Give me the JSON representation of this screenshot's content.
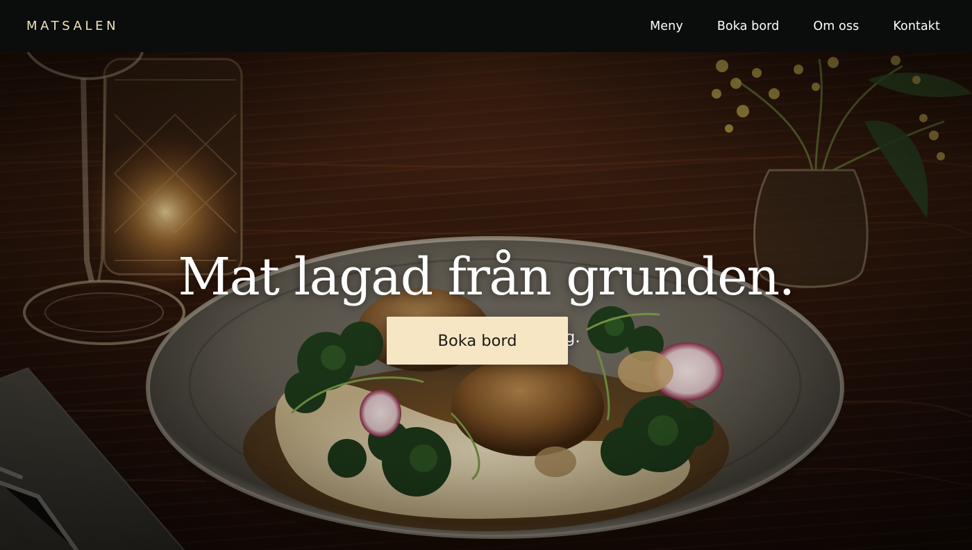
{
  "header": {
    "brand": "MATSALEN",
    "nav": [
      {
        "label": "Meny"
      },
      {
        "label": "Boka bord"
      },
      {
        "label": "Om oss"
      },
      {
        "label": "Kontakt"
      }
    ]
  },
  "hero": {
    "headline": "Mat lagad från grunden.",
    "subline": "Öppet tisdag till lördag.",
    "cta_label": "Boka bord"
  },
  "colors": {
    "header_bg": "#0b0d0c",
    "brand_text": "#efe2c0",
    "cta_bg": "#f7e6c4",
    "cta_text": "#1c1a14",
    "text_light": "#ffffff"
  }
}
